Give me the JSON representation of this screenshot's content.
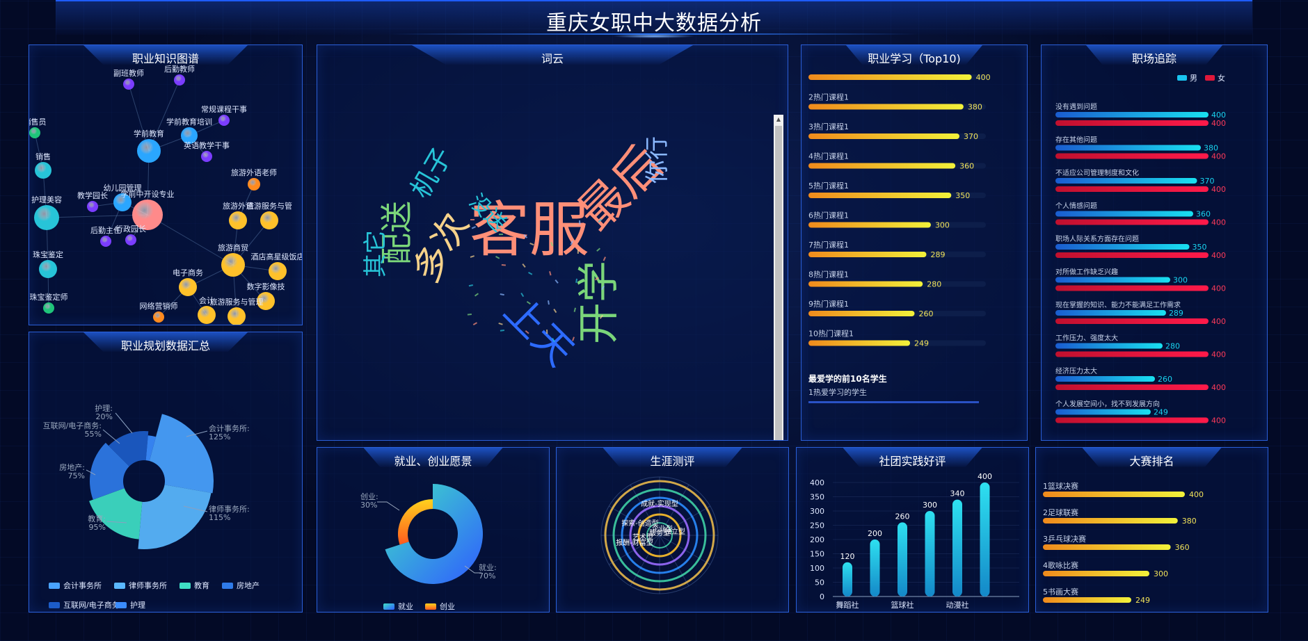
{
  "title": "重庆女职中大数据分析",
  "panels": {
    "graph": "职业知识图谱",
    "plan": "职业规划数据汇总",
    "cloud": "词云",
    "study": "职业学习（Top10)",
    "track": "职场追踪",
    "employ": "就业、创业愿景",
    "career": "生涯测评",
    "club": "社团实践好评",
    "contest": "大赛排名"
  },
  "graph_nodes": [
    {
      "label": "副班教师",
      "color": "#7b3dff"
    },
    {
      "label": "后勤教师",
      "color": "#7b3dff"
    },
    {
      "label": "常规课程干事",
      "color": "#7b3dff"
    },
    {
      "label": "学前教育",
      "color": "#2aa6ff"
    },
    {
      "label": "学前教育培训",
      "color": "#2aa6ff"
    },
    {
      "label": "英语教学干事",
      "color": "#7b3dff"
    },
    {
      "label": "销售员",
      "color": "#1fc47a"
    },
    {
      "label": "销售",
      "color": "#27c4d8"
    },
    {
      "label": "教学园长",
      "color": "#7b3dff"
    },
    {
      "label": "幼儿园管理",
      "color": "#2aa6ff"
    },
    {
      "label": "学前中开设专业",
      "color": "#ff8a8a"
    },
    {
      "label": "护理美容",
      "color": "#27c4d8"
    },
    {
      "label": "后勤主任",
      "color": "#7b3dff"
    },
    {
      "label": "行政园长",
      "color": "#7b3dff"
    },
    {
      "label": "旅游外语老师",
      "color": "#ff8a1e"
    },
    {
      "label": "旅游外语",
      "color": "#ffc12a"
    },
    {
      "label": "旅游服务与管",
      "color": "#ffc12a"
    },
    {
      "label": "珠宝鉴定",
      "color": "#27c4d8"
    },
    {
      "label": "旅游商贸",
      "color": "#ffc12a"
    },
    {
      "label": "酒店高星级饭店",
      "color": "#ffc12a"
    },
    {
      "label": "电子商务",
      "color": "#ffc12a"
    },
    {
      "label": "数字影像技",
      "color": "#ffc12a"
    },
    {
      "label": "珠宝鉴定师",
      "color": "#1fc47a"
    },
    {
      "label": "网络营销师",
      "color": "#ff8a1e"
    },
    {
      "label": "会计",
      "color": "#ffc12a"
    },
    {
      "label": "旅游服务与管理",
      "color": "#ffc12a"
    }
  ],
  "plan_chart": {
    "type": "pie",
    "legend": [
      "会计事务所",
      "律师事务所",
      "教育",
      "房地产",
      "互联网/电子商务",
      "护理"
    ],
    "colors": [
      "#4aa3ff",
      "#5ab8ff",
      "#3fe0c5",
      "#2f7be8",
      "#1c5cc8",
      "#3a8cff"
    ],
    "labels": [
      {
        "name": "会计事务所",
        "value": "125%"
      },
      {
        "name": "律师事务所",
        "value": "115%"
      },
      {
        "name": "教育",
        "value": "95%"
      },
      {
        "name": "房地产",
        "value": "75%"
      },
      {
        "name": "互联网/电子商务",
        "value": "55%"
      },
      {
        "name": "护理",
        "value": "20%"
      }
    ]
  },
  "cloud_words": [
    "客服",
    "最后",
    "开学",
    "上天",
    "多次",
    "配送",
    "机子",
    "你行",
    "没送",
    "其它"
  ],
  "study_items": [
    {
      "label": "",
      "value": "400"
    },
    {
      "label": "2热门课程1",
      "value": "380"
    },
    {
      "label": "3热门课程1",
      "value": "370"
    },
    {
      "label": "4热门课程1",
      "value": "360"
    },
    {
      "label": "5热门课程1",
      "value": "350"
    },
    {
      "label": "6热门课程1",
      "value": "300"
    },
    {
      "label": "7热门课程1",
      "value": "289"
    },
    {
      "label": "8热门课程1",
      "value": "280"
    },
    {
      "label": "9热门课程1",
      "value": "260"
    },
    {
      "label": "10热门课程1",
      "value": "249"
    }
  ],
  "study_sub": {
    "title": "最爱学的前10名学生",
    "first": "1热爱学习的学生"
  },
  "track": {
    "legend": [
      "男",
      "女"
    ],
    "items": [
      {
        "label": "没有遇到问题",
        "m": "400",
        "f": "400"
      },
      {
        "label": "存在其他问题",
        "m": "380",
        "f": "400"
      },
      {
        "label": "不适应公司管理制度和文化",
        "m": "370",
        "f": "400"
      },
      {
        "label": "个人情感问题",
        "m": "360",
        "f": "400"
      },
      {
        "label": "职场人际关系方面存在问题",
        "m": "350",
        "f": "400"
      },
      {
        "label": "对所做工作缺乏兴趣",
        "m": "300",
        "f": "400"
      },
      {
        "label": "现在掌握的知识、能力不能满足工作需求",
        "m": "289",
        "f": "400"
      },
      {
        "label": "工作压力、强度太大",
        "m": "280",
        "f": "400"
      },
      {
        "label": "经济压力太大",
        "m": "260",
        "f": "400"
      },
      {
        "label": "个人发展空间小，找不到发展方向",
        "m": "249",
        "f": "400"
      }
    ]
  },
  "employ_chart": {
    "type": "pie",
    "legend": [
      "就业",
      "创业"
    ],
    "labels": [
      {
        "name": "创业",
        "value": "30%"
      },
      {
        "name": "就业",
        "value": "70%"
      }
    ]
  },
  "career_labels": [
    "成就-实现型",
    "艺术型",
    "企业型",
    "独立型",
    "服务型",
    "探索-创造型",
    "报酬-财富型"
  ],
  "club_chart": {
    "type": "bar",
    "categories": [
      "舞蹈社",
      "",
      "篮球社",
      "",
      "动漫社",
      ""
    ],
    "x_labels": [
      "舞蹈社",
      "篮球社",
      "动漫社"
    ],
    "values": [
      120,
      200,
      260,
      300,
      340,
      400
    ],
    "ylim": [
      0,
      400
    ],
    "yticks": [
      "0",
      "50",
      "100",
      "150",
      "200",
      "250",
      "300",
      "350",
      "400"
    ]
  },
  "contest_items": [
    {
      "label": "1篮球决赛",
      "value": "400"
    },
    {
      "label": "2足球联赛",
      "value": "380"
    },
    {
      "label": "3乒乓球决赛",
      "value": "360"
    },
    {
      "label": "4歌咏比赛",
      "value": "300"
    },
    {
      "label": "5书画大赛",
      "value": "249"
    }
  ]
}
